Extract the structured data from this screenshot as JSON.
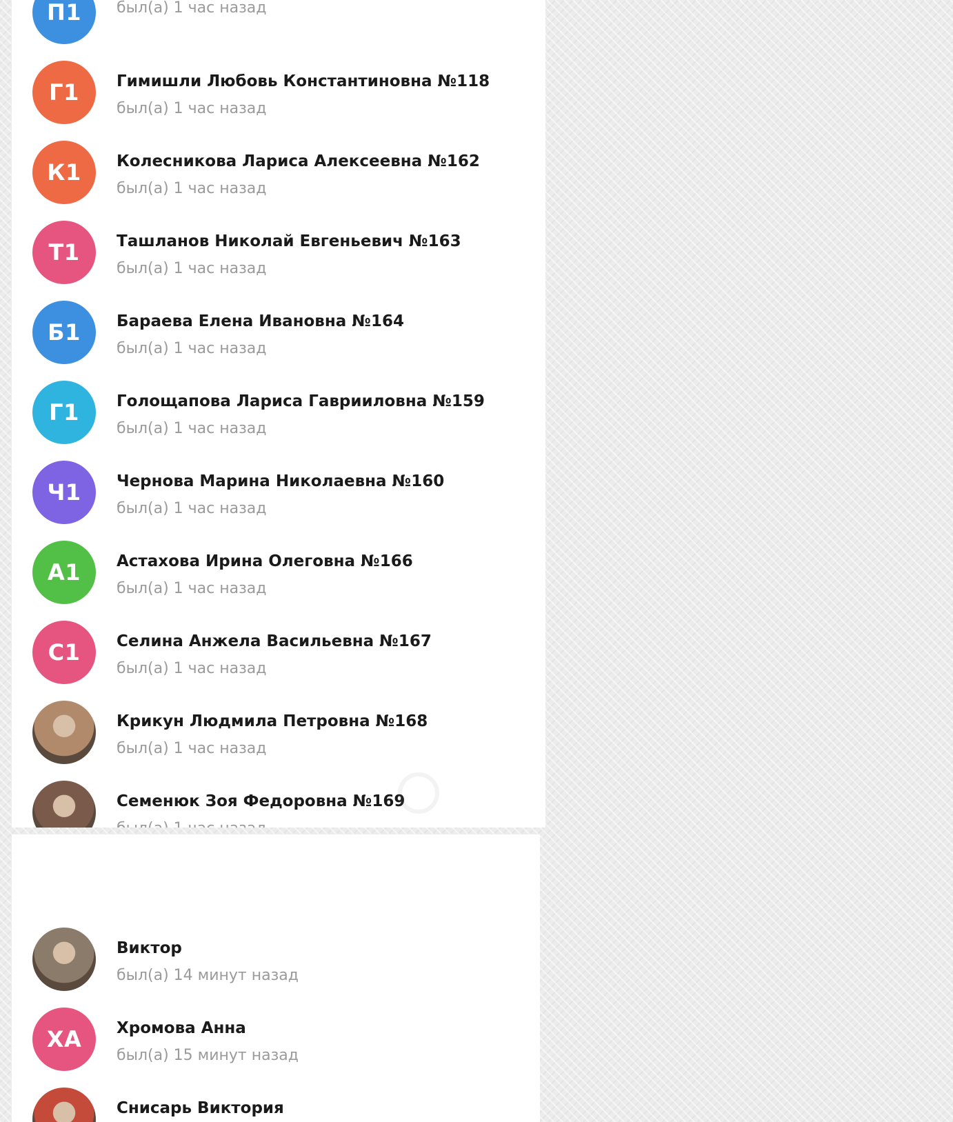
{
  "top_list": [
    {
      "initials": "П1",
      "name": "",
      "status": "был(а) 1 час назад",
      "color": "#3d8fe0",
      "photo": false
    },
    {
      "initials": "Г1",
      "name": "Гимишли Любовь Константиновна №118",
      "status": "был(а) 1 час назад",
      "color": "#ee6a45",
      "photo": false
    },
    {
      "initials": "К1",
      "name": "Колесникова Лариса Алексеевна №162",
      "status": "был(а) 1 час назад",
      "color": "#ee6a45",
      "photo": false
    },
    {
      "initials": "Т1",
      "name": "Ташланов Николай Евгеньевич №163",
      "status": "был(а) 1 час назад",
      "color": "#e5557f",
      "photo": false
    },
    {
      "initials": "Б1",
      "name": "Бараева Елена Ивановна №164",
      "status": "был(а) 1 час назад",
      "color": "#3d8fe0",
      "photo": false
    },
    {
      "initials": "Г1",
      "name": "Голощапова Лариса Гаврииловна №159",
      "status": "был(а) 1 час назад",
      "color": "#2fb4e0",
      "photo": false
    },
    {
      "initials": "Ч1",
      "name": "Чернова Марина Николаевна №160",
      "status": "был(а) 1 час назад",
      "color": "#7e63e3",
      "photo": false
    },
    {
      "initials": "А1",
      "name": "Астахова Ирина Олеговна №166",
      "status": "был(а) 1 час назад",
      "color": "#52c047",
      "photo": false
    },
    {
      "initials": "С1",
      "name": "Селина Анжела Васильевна №167",
      "status": "был(а) 1 час назад",
      "color": "#e5557f",
      "photo": false
    },
    {
      "initials": "",
      "name": "Крикун Людмила Петровна №168",
      "status": "был(а) 1 час назад",
      "color": "#b08a6a",
      "photo": true
    },
    {
      "initials": "",
      "name": "Семенюк Зоя Федоровна №169",
      "status": "был(а) 1 час назад",
      "color": "#7a5a4a",
      "photo": true
    }
  ],
  "bottom_list": [
    {
      "initials": "",
      "name": "Виктор",
      "status": "был(а) 14 минут назад",
      "color": "#8a7b6a",
      "photo": true
    },
    {
      "initials": "ХА",
      "name": "Хромова Анна",
      "status": "был(а) 15 минут назад",
      "color": "#e5557f",
      "photo": false
    },
    {
      "initials": "",
      "name": "Снисарь Виктория",
      "status": "",
      "color": "#c44a3a",
      "photo": true
    }
  ]
}
